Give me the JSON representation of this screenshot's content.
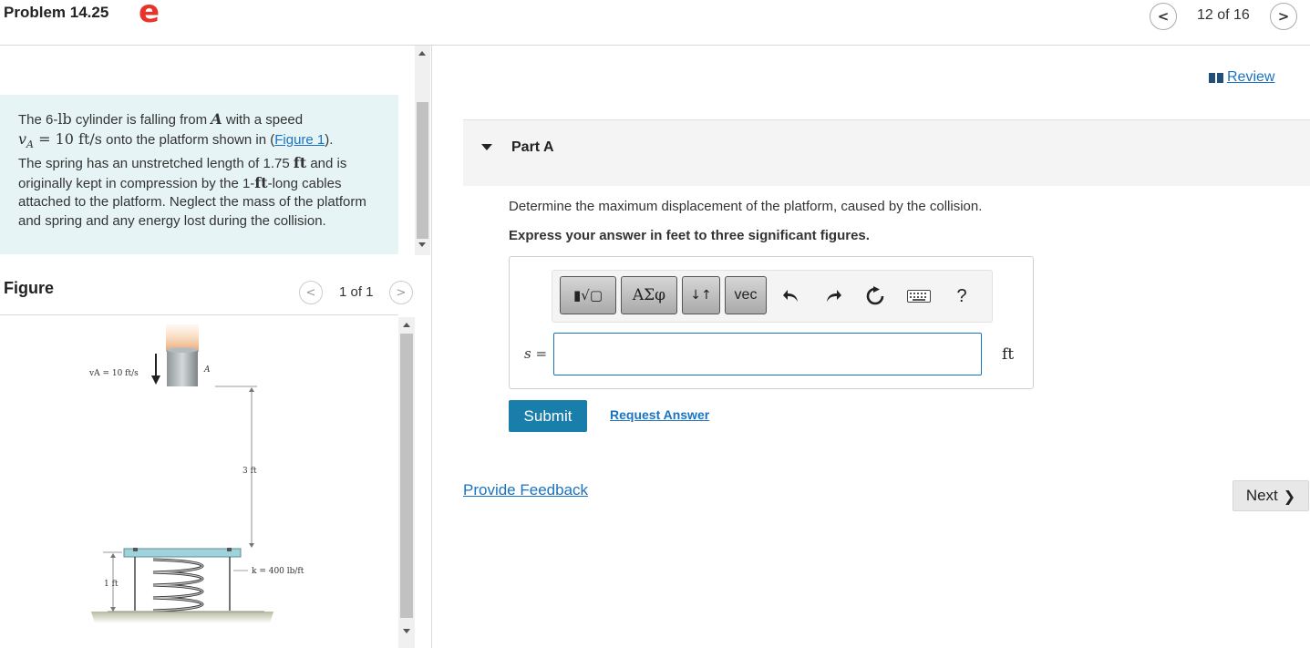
{
  "header": {
    "title": "Problem 14.25",
    "etext_glyph": "e",
    "counter": "12 of 16",
    "prev": "<",
    "next": ">"
  },
  "problem": {
    "t1": "The 6-",
    "t1_unit": "lb",
    "t2": " cylinder is falling from ",
    "t2_var": "A",
    "t3": " with a speed",
    "v_sym": "v",
    "v_sub": "A",
    "v_val": " = 10 ft/s",
    "t4": " onto the platform shown in (",
    "figure_link": "Figure 1",
    "t5": ").",
    "t6": "The spring has an unstretched length of 1.75 ",
    "t6_unit": "ft",
    "t7": " and is originally kept in compression by the 1-",
    "t7_unit": "ft",
    "t8": "-long cables attached to the platform. Neglect the mass of the platform and spring and any energy lost during the collision."
  },
  "figure": {
    "label": "Figure",
    "counter": "1 of 1",
    "prev": "<",
    "next": ">",
    "v_label": "vA = 10 ft/s",
    "a_label": "A",
    "dim_3ft": "3 ft",
    "dim_1ft": "1 ft",
    "k_label": "k = 400 lb/ft"
  },
  "review": {
    "label": "Review"
  },
  "part": {
    "title": "Part A",
    "question": "Determine the maximum displacement of the platform, caused by the collision.",
    "instruction": "Express your answer in feet to three significant figures."
  },
  "toolbar": {
    "templates": "▮√▢",
    "greek": "ΑΣφ",
    "arrows": "↓↑",
    "vec": "vec",
    "help": "?"
  },
  "answer": {
    "var": "s",
    "eq": " =",
    "value": "",
    "placeholder": "",
    "unit": "ft"
  },
  "actions": {
    "submit": "Submit",
    "request": "Request Answer",
    "feedback": "Provide Feedback",
    "next": "Next"
  }
}
